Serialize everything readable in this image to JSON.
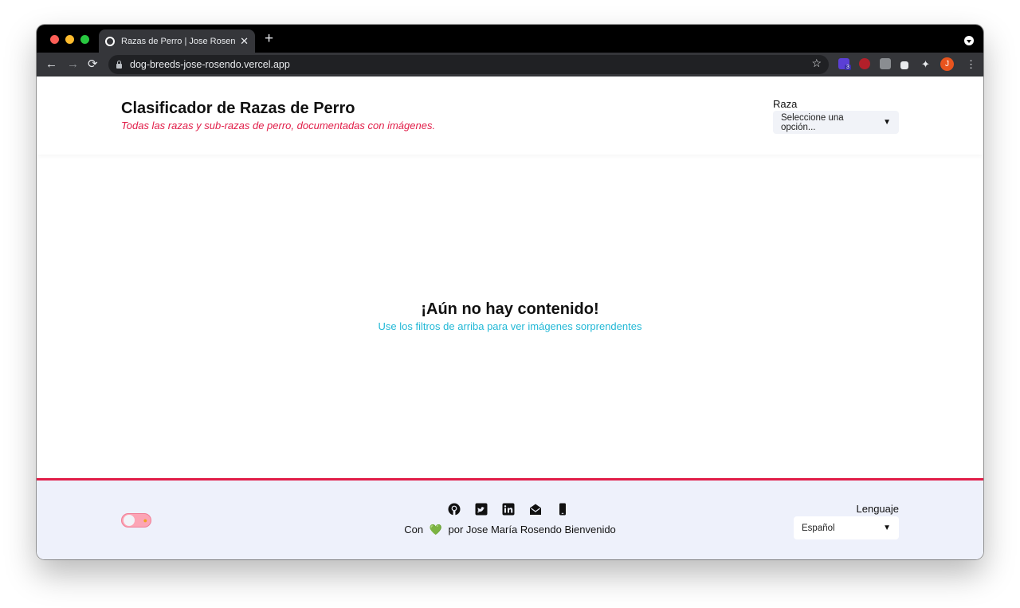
{
  "browser": {
    "tab_title": "Razas de Perro | Jose Rosendo Bienvenido",
    "tab_close": "✕",
    "new_tab": "+",
    "url": "dog-breeds-jose-rosendo.vercel.app",
    "extension_badge": "3",
    "profile_initial": "J",
    "traffic_lights": [
      "#ff5f57",
      "#febc2e",
      "#28c840"
    ]
  },
  "header": {
    "title": "Clasificador de Razas de Perro",
    "subtitle": "Todas las razas y sub-razas de perro, documentadas con imágenes.",
    "breed_label": "Raza",
    "breed_select_value": "Seleccione una opción..."
  },
  "main": {
    "empty_title": "¡Aún no hay contenido!",
    "empty_subtitle": "Use los filtros de arriba para ver imágenes sorprendentes"
  },
  "footer": {
    "credit_prefix": "Con",
    "credit_heart": "💚",
    "credit_author": "por Jose María Rosendo Bienvenido",
    "language_label": "Lenguaje",
    "language_value": "Español",
    "socials": [
      "github-icon",
      "twitter-icon",
      "linkedin-icon",
      "mail-icon",
      "phone-icon"
    ]
  },
  "colors": {
    "accent": "#e11d48",
    "subtitle_cyan": "#22b8d6",
    "footer_bg": "#eef1fb"
  }
}
